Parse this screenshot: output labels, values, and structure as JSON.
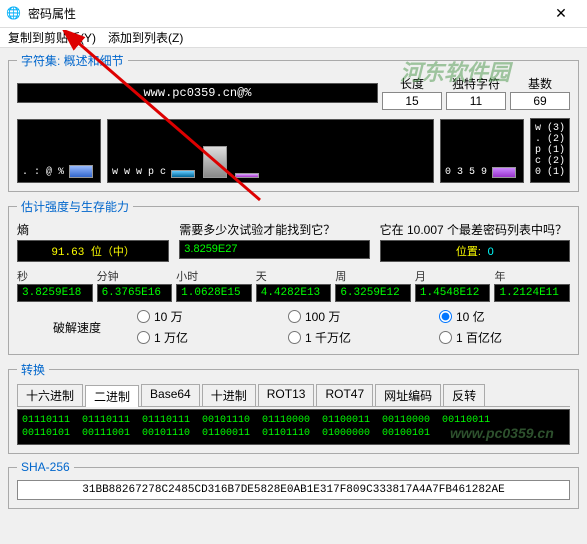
{
  "window": {
    "title": "密码属性",
    "close": "✕"
  },
  "menu": {
    "copy": "复制到剪贴板(Y)",
    "add": "添加到列表(Z)"
  },
  "charset": {
    "label": "字符集: 概述和细节",
    "password": "www.pc0359.cn@%",
    "len_label": "长度",
    "len": "15",
    "uniq_label": "独特字符",
    "uniq": "11",
    "base_label": "基数",
    "base": "69"
  },
  "bars": {
    "g1_labels": ".\n:\n@\n%",
    "g2_labels": "w\nw\nw\np\nc",
    "g3_labels": "0\n3\n5\n9",
    "g4_labels": "w (3)\n. (2)\np (1)\nc (2)\n0 (1)"
  },
  "est": {
    "legend": "估计强度与生存能力",
    "entropy_label": "熵",
    "entropy_val": "91.63 位（中）",
    "tries_label": "需要多少次试验才能找到它？",
    "tries_val": "3.8259E27",
    "worst_label": "它在 10.007 个最差密码列表中吗？",
    "worst_val_lbl": "位置:",
    "worst_val": "0"
  },
  "time": {
    "sec_l": "秒",
    "sec_v": "3.8259E18",
    "min_l": "分钟",
    "min_v": "6.3765E16",
    "hr_l": "小时",
    "hr_v": "1.0628E15",
    "day_l": "天",
    "day_v": "4.4282E13",
    "wk_l": "周",
    "wk_v": "6.3259E12",
    "mo_l": "月",
    "mo_v": "1.4548E12",
    "yr_l": "年",
    "yr_v": "1.2124E11"
  },
  "speed": {
    "label": "破解速度",
    "r1": "10 万",
    "r2": "100 万",
    "r3": "10 亿",
    "r4": "1 万亿",
    "r5": "1 千万亿",
    "r6": "1 百亿亿"
  },
  "convert": {
    "legend": "转换",
    "tabs": [
      "十六进制",
      "二进制",
      "Base64",
      "十进制",
      "ROT13",
      "ROT47",
      "网址编码",
      "反转"
    ],
    "binary": "01110111 01110111 01110111 00101110 01110000 01100011 00110000 00110011\n00110101 00111001 00101110 01100011 01101110 01000000 00100101"
  },
  "sha": {
    "legend": "SHA-256",
    "value": "31BB88267278C2485CD316B7DE5828E0AB1E317F809C333817A4A7FB461282AE"
  },
  "watermark": "河东软件园",
  "watermark2": "www.pc0359.cn"
}
